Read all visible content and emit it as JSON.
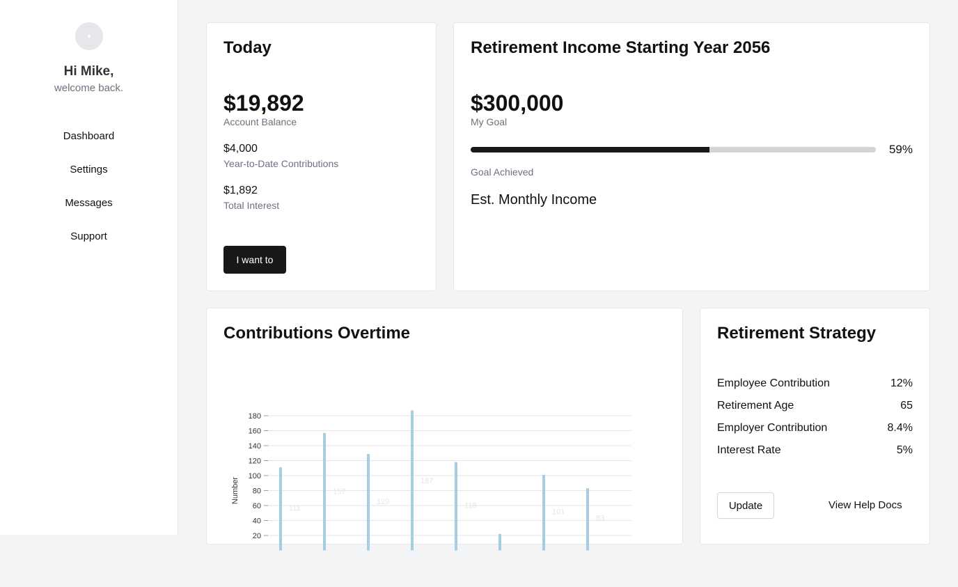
{
  "sidebar": {
    "greeting": "Hi Mike,",
    "welcome": "welcome back.",
    "items": [
      {
        "label": "Dashboard"
      },
      {
        "label": "Settings"
      },
      {
        "label": "Messages"
      },
      {
        "label": "Support"
      }
    ]
  },
  "today": {
    "title": "Today",
    "balance": "$19,892",
    "balance_label": "Account Balance",
    "ytd": "$4,000",
    "ytd_label": "Year-to-Date Contributions",
    "interest": "$1,892",
    "interest_label": "Total Interest",
    "button": "I want to"
  },
  "retirement": {
    "title": "Retirement Income Starting Year 2056",
    "goal": "$300,000",
    "goal_label": "My Goal",
    "progress_percent": 59,
    "progress_text": "59%",
    "achieved_label": "Goal Achieved",
    "monthly_label": "Est. Monthly Income"
  },
  "contributions": {
    "title": "Contributions Overtime"
  },
  "chart_data": {
    "type": "bar",
    "title": "",
    "xlabel": "",
    "ylabel": "Number",
    "ylim": [
      0,
      180
    ],
    "yticks": [
      20,
      40,
      60,
      80,
      100,
      120,
      140,
      160,
      180
    ],
    "values": [
      111,
      157,
      129,
      187,
      118,
      22,
      101,
      83
    ],
    "data_labels": [
      "111",
      "157",
      "129",
      "187",
      "118",
      "",
      "101",
      "83"
    ],
    "bar_color": "#a7cde3",
    "grid": true
  },
  "strategy": {
    "title": "Retirement Strategy",
    "rows": [
      {
        "label": "Employee Contribution",
        "value": "12%"
      },
      {
        "label": "Retirement Age",
        "value": "65"
      },
      {
        "label": "Employer Contribution",
        "value": "8.4%"
      },
      {
        "label": "Interest Rate",
        "value": "5%"
      }
    ],
    "update_button": "Update",
    "help_button": "View Help Docs"
  }
}
